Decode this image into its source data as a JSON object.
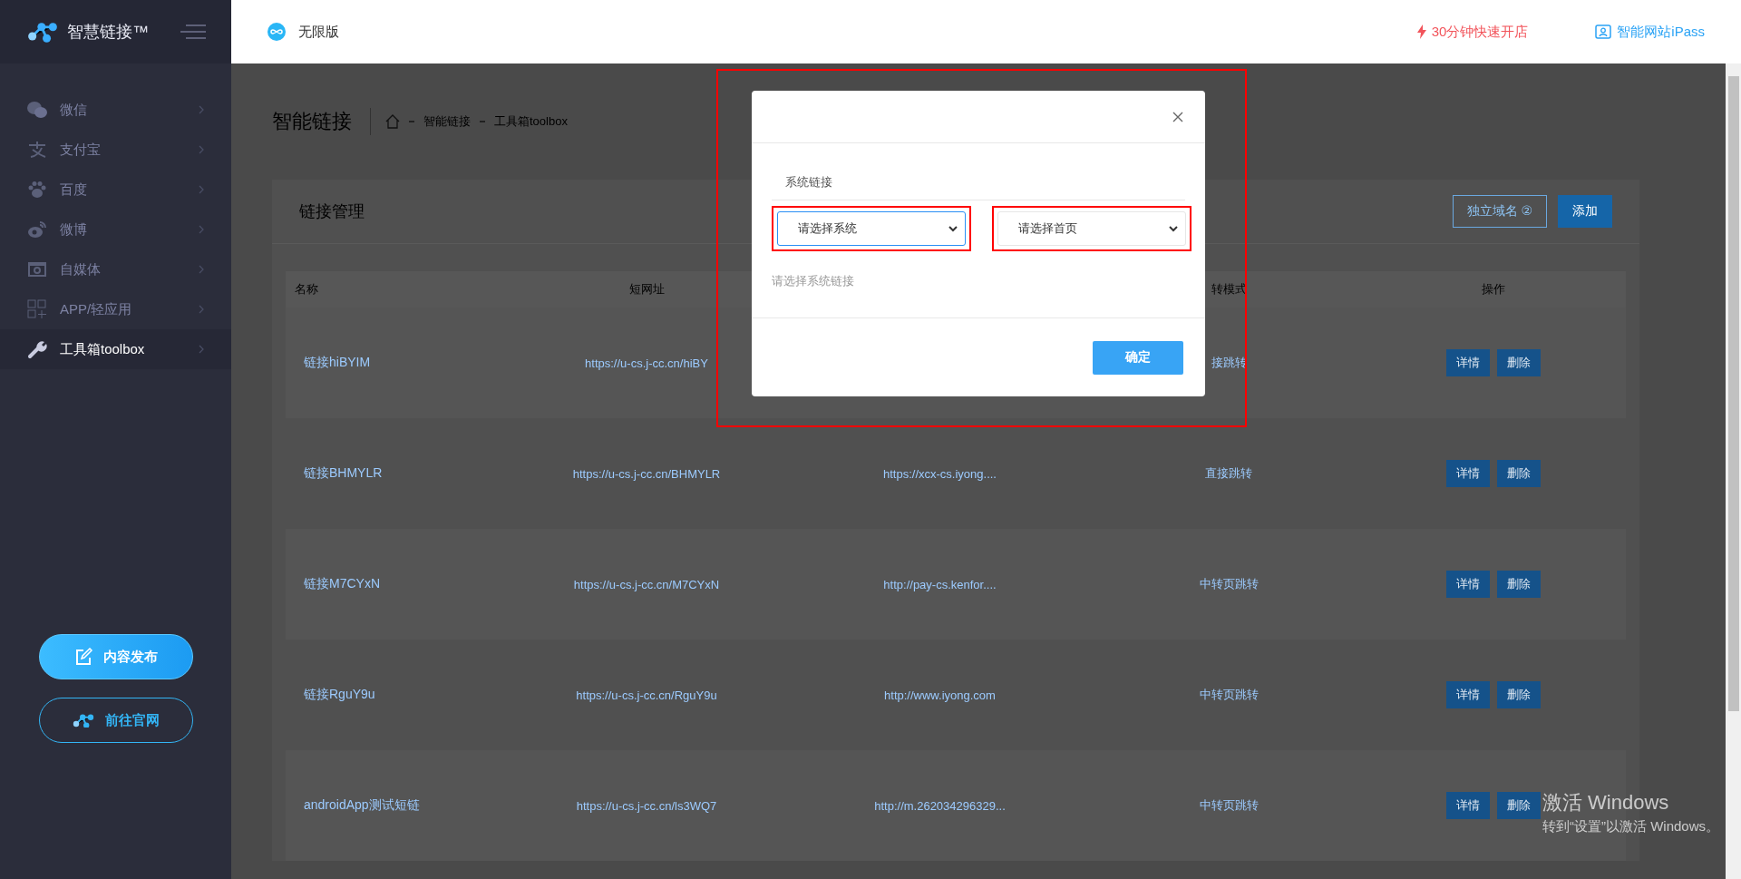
{
  "brand": {
    "name": "智慧链接™"
  },
  "sidebar": {
    "items": [
      {
        "label": "微信",
        "selected": false
      },
      {
        "label": "支付宝",
        "selected": false
      },
      {
        "label": "百度",
        "selected": false
      },
      {
        "label": "微博",
        "selected": false
      },
      {
        "label": "自媒体",
        "selected": false
      },
      {
        "label": "APP/轻应用",
        "selected": false
      },
      {
        "label": "工具箱toolbox",
        "selected": true
      }
    ],
    "buttons": [
      {
        "label": "内容发布",
        "kind": "filled"
      },
      {
        "label": "前往官网",
        "kind": "outline"
      }
    ]
  },
  "header": {
    "edition": "无限版",
    "links": [
      {
        "label": "30分钟快速开店",
        "kind": "promo"
      },
      {
        "label": "智能网站iPass",
        "kind": "site"
      }
    ]
  },
  "page": {
    "title": "智能链接",
    "breadcrumb": [
      "智能链接",
      "工具箱toolbox"
    ]
  },
  "card": {
    "title": "链接管理",
    "buttons": [
      {
        "label": "独立域名",
        "badge": "②",
        "kind": "outline"
      },
      {
        "label": "添加",
        "kind": "filled"
      }
    ]
  },
  "table": {
    "columns": [
      "名称",
      "短网址",
      "",
      "转模式",
      "操作"
    ],
    "rows": [
      {
        "name": "链接hiBYIM",
        "short_url": "https://u-cs.j-cc.cn/hiBY",
        "target": "",
        "mode": "接跳转",
        "actions": [
          "详情",
          "删除"
        ]
      },
      {
        "name": "链接BHMYLR",
        "short_url": "https://u-cs.j-cc.cn/BHMYLR",
        "target": "https://xcx-cs.iyong....",
        "mode": "直接跳转",
        "actions": [
          "详情",
          "删除"
        ]
      },
      {
        "name": "链接M7CYxN",
        "short_url": "https://u-cs.j-cc.cn/M7CYxN",
        "target": "http://pay-cs.kenfor....",
        "mode": "中转页跳转",
        "actions": [
          "详情",
          "删除"
        ]
      },
      {
        "name": "链接RguY9u",
        "short_url": "https://u-cs.j-cc.cn/RguY9u",
        "target": "http://www.iyong.com",
        "mode": "中转页跳转",
        "actions": [
          "详情",
          "删除"
        ]
      },
      {
        "name": "androidApp测试短链",
        "short_url": "https://u-cs.j-cc.cn/ls3WQ7",
        "target": "http://m.262034296329...",
        "mode": "中转页跳转",
        "actions": [
          "详情",
          "删除"
        ]
      }
    ]
  },
  "modal": {
    "annotated": true,
    "section": "系统链接",
    "selects": [
      {
        "placeholder": "请选择系统",
        "focused": true,
        "annotated": true
      },
      {
        "placeholder": "请选择首页",
        "focused": false,
        "annotated": true
      }
    ],
    "hint": "请选择系统链接",
    "confirm": "确定"
  },
  "os_watermark": {
    "title": "激活 Windows",
    "text": "转到“设置”以激活 Windows。"
  }
}
